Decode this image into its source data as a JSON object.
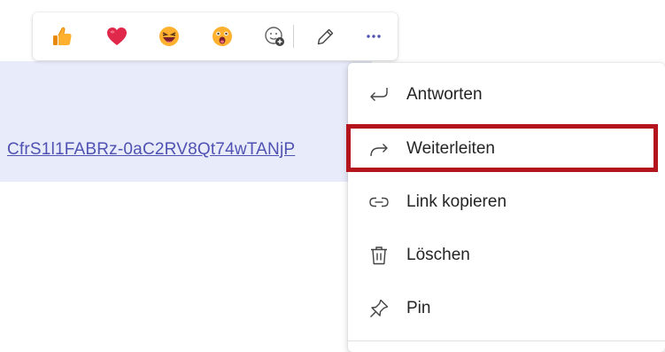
{
  "message": {
    "link_text": "CfrS1l1FABRz-0aC2RV8Qt74wTANjP"
  },
  "reaction_bar": {
    "reactions": [
      {
        "name": "like",
        "icon": "thumbs-up-icon"
      },
      {
        "name": "heart",
        "icon": "heart-icon"
      },
      {
        "name": "laugh",
        "icon": "laughing-face-icon"
      },
      {
        "name": "surprised",
        "icon": "surprised-face-icon"
      },
      {
        "name": "more-reactions",
        "icon": "add-emoji-icon"
      }
    ],
    "edit_icon": "pencil-icon",
    "more_icon": "more-options-icon"
  },
  "context_menu": {
    "items": [
      {
        "label": "Antworten",
        "icon": "reply-icon"
      },
      {
        "label": "Weiterleiten",
        "icon": "forward-icon",
        "highlighted": true
      },
      {
        "label": "Link kopieren",
        "icon": "link-icon"
      },
      {
        "label": "Löschen",
        "icon": "trash-icon"
      },
      {
        "label": "Pin",
        "icon": "pin-icon"
      }
    ]
  },
  "colors": {
    "accent": "#4f52b2",
    "highlight_border": "#b4141c",
    "message_bg": "#e8ebfa"
  }
}
